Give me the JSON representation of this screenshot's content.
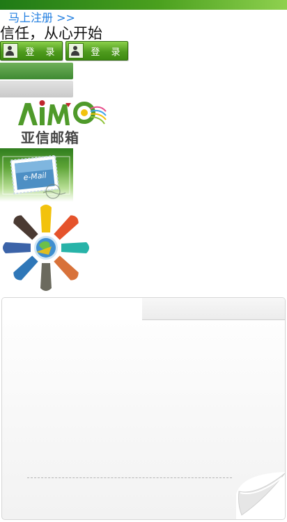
{
  "header": {
    "register_link": "马上注册 >>",
    "slogan": "信任，从心开始"
  },
  "login_buttons": [
    {
      "label": "登 录",
      "icon": "user-icon"
    },
    {
      "label": "登 录",
      "icon": "user-icon"
    }
  ],
  "logo": {
    "wordmark": "AiMC",
    "chinese_name": "亚信邮箱"
  },
  "email_banner": {
    "stamp_text": "e-Mail"
  },
  "colors": {
    "accent_green": "#3c8a10",
    "link_blue": "#1f7de0",
    "top_bar": "#2f8a1a"
  }
}
